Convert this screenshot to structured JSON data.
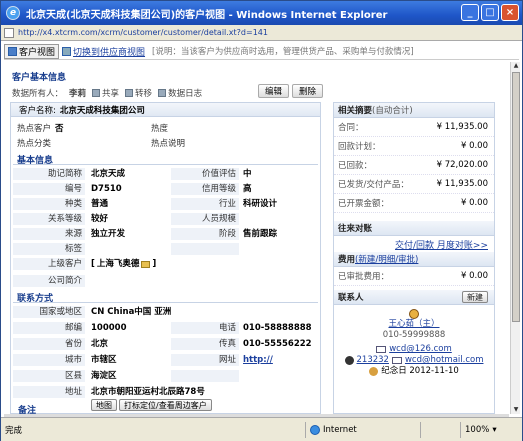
{
  "window": {
    "title": "北京天成(北京天成科技集团公司)的客户视图 - Windows Internet Explorer",
    "url": "http://x4.xtcrm.com/xcrm/customer/customer/detail.xt?d=141"
  },
  "toolbar": {
    "customer_view": "客户视图",
    "switch_supplier": "切换到供应商视图",
    "hint": "[说明：当该客户为供应商时选用，管理供货产品、采购单与付款情况]"
  },
  "basic": {
    "section_title": "客户基本信息",
    "owner_label": "数据所有人：",
    "owner": "李莉",
    "share": "共享",
    "transfer": "转移",
    "log": "数据日志",
    "edit_btn": "编辑",
    "delete_btn": "删除",
    "cname_label": "客户名称:",
    "cname": "北京天成科技集团公司",
    "hot_customer_label": "热点客户",
    "hot_customer": "否",
    "heat_label": "热度",
    "hot_class_label": "热点分类",
    "hot_desc_label": "热点说明"
  },
  "info": {
    "title": "基本信息",
    "rows": [
      {
        "k1": "助记简称",
        "v1": "北京天成",
        "k2": "价值评估",
        "v2": "中"
      },
      {
        "k1": "编号",
        "v1": "D7510",
        "k2": "信用等级",
        "v2": "高"
      },
      {
        "k1": "种类",
        "v1": "普通",
        "k2": "行业",
        "v2": "科研设计"
      },
      {
        "k1": "关系等级",
        "v1": "较好",
        "k2": "人员规模",
        "v2": ""
      },
      {
        "k1": "来源",
        "v1": "独立开发",
        "k2": "阶段",
        "v2": "售前跟踪"
      },
      {
        "k1": "标签",
        "v1": "",
        "k2": "",
        "v2": ""
      }
    ],
    "parent_label": "上级客户",
    "parent": "上海飞奥德",
    "intro_label": "公司简介"
  },
  "contact": {
    "title": "联系方式",
    "region_label": "国家或地区",
    "region": "CN China中国  亚洲",
    "rows": [
      {
        "k1": "邮编",
        "v1": "100000",
        "k2": "电话",
        "v2": "010-58888888"
      },
      {
        "k1": "省份",
        "v1": "北京",
        "k2": "传真",
        "v2": "010-55556222"
      },
      {
        "k1": "城市",
        "v1": "市辖区",
        "k2": "网址",
        "v2": "http://"
      },
      {
        "k1": "区县",
        "v1": "海淀区",
        "k2": "",
        "v2": ""
      }
    ],
    "address_label": "地址",
    "address": "北京市朝阳亚运村北辰路78号",
    "map_btn": "地图",
    "locate_btn": "打标定位/查看周边客户",
    "remark_label": "备注"
  },
  "summary": {
    "title": "相关摘要",
    "auto": "(自动合计)",
    "rows": [
      {
        "k": "合同：",
        "v": "¥ 11,935.00"
      },
      {
        "k": "回款计划：",
        "v": "¥ 0.00"
      },
      {
        "k": "已回款：",
        "v": "¥ 72,020.00"
      },
      {
        "k": "已发货/交付产品：",
        "v": "¥ 11,935.00"
      },
      {
        "k": "已开票金额：",
        "v": "¥ 0.00"
      }
    ],
    "dealings_title": "往来对账",
    "dealings_links": "交付/回款  月度对账>>",
    "fee_title": "费用",
    "fee_links": "(新建/明细/审批)",
    "fee_row": {
      "k": "已审批费用：",
      "v": "¥ 0.00"
    },
    "contact_title": "联系人",
    "new_btn": "新建",
    "person_name": "王心茹（主）",
    "person_phone": "010-59999888",
    "email1": "wcd@126.com",
    "qq": "213232",
    "email2": "wcd@hotmail.com",
    "anniv": "纪念日 2012-11-10"
  },
  "status": {
    "done": "完成",
    "zone": "Internet",
    "zoom": "100%"
  }
}
